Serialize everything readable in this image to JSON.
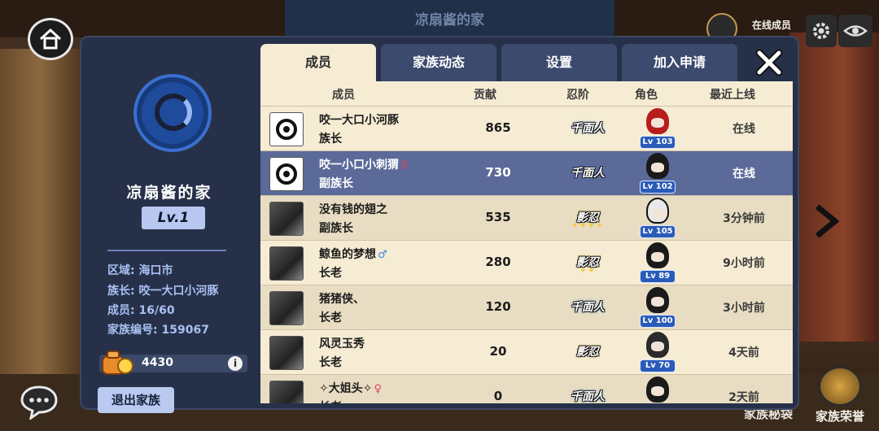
{
  "background": {
    "sign_title": "凉扇酱的家",
    "online_label": "在线成员",
    "bag_label": "家族秘袋",
    "honor_label": "家族荣誉"
  },
  "sidebar": {
    "clan_name": "凉扇酱的家",
    "level": "Lv.1",
    "region_label": "区域:",
    "region": "海口市",
    "leader_label": "族长:",
    "leader": "咬一大口小河豚",
    "members_label": "成员:",
    "members": "16/60",
    "clan_id_label": "家族编号:",
    "clan_id": "159067",
    "coins": "4430",
    "info_icon": "i",
    "quit_button": "退出家族"
  },
  "tabs": [
    {
      "label": "成员",
      "active": true
    },
    {
      "label": "家族动态",
      "active": false
    },
    {
      "label": "设置",
      "active": false
    },
    {
      "label": "加入申请",
      "active": false
    }
  ],
  "table": {
    "headers": {
      "member": "成员",
      "contribution": "贡献",
      "rank": "忍阶",
      "role": "角色",
      "last_online": "最近上线"
    },
    "rows": [
      {
        "name": "咬一大口小河豚",
        "gender": "",
        "position": "族长",
        "contribution": "865",
        "rank": "千面人",
        "level": "Lv 103",
        "last_online": "在线"
      },
      {
        "name": "咬一小口小刺猬",
        "gender": "♀",
        "position": "副族长",
        "contribution": "730",
        "rank": "千面人",
        "level": "Lv 102",
        "last_online": "在线"
      },
      {
        "name": "没有钱的翅之",
        "gender": "",
        "position": "副族长",
        "contribution": "535",
        "rank": "影忍",
        "level": "Lv 105",
        "last_online": "3分钟前"
      },
      {
        "name": "鲸鱼的梦想",
        "gender": "♂",
        "position": "长老",
        "contribution": "280",
        "rank": "影忍",
        "level": "Lv 89",
        "last_online": "9小时前"
      },
      {
        "name": "猪猪侠、",
        "gender": "",
        "position": "长老",
        "contribution": "120",
        "rank": "千面人",
        "level": "Lv 100",
        "last_online": "3小时前"
      },
      {
        "name": "风灵玉秀",
        "gender": "",
        "position": "长老",
        "contribution": "20",
        "rank": "影忍",
        "level": "Lv 70",
        "last_online": "4天前"
      },
      {
        "name": "✧大姐头✧",
        "gender": "♀",
        "position": "长老",
        "contribution": "0",
        "rank": "千面人",
        "level": "",
        "last_online": "2天前"
      }
    ]
  },
  "colors": {
    "panel": "#263149",
    "tab_active": "#f6ecd4",
    "row_selected": "#5b6a99",
    "accent_blue": "#2a5bb8"
  }
}
